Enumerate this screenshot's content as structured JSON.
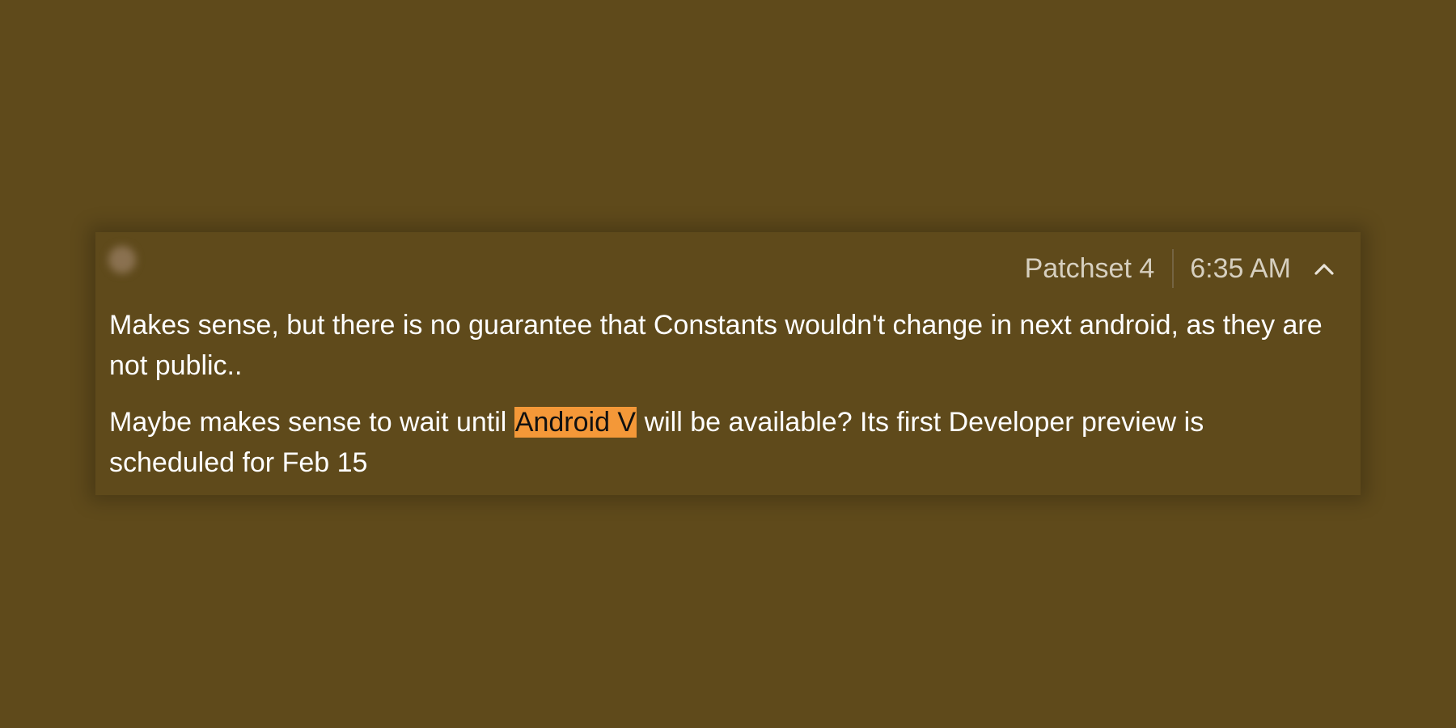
{
  "comment": {
    "author": "",
    "patchset_label": "Patchset 4",
    "time": "6:35 AM",
    "collapse_icon": "chevron-up-icon",
    "paragraphs": {
      "p1": {
        "line1": "Makes sense, but there is no guarantee that Constants wouldn't change in next android, as they are",
        "line2": "not public.."
      },
      "p2": {
        "before": "Maybe makes sense to wait until ",
        "highlight": "Android V",
        "after": " will be available? Its first Developer preview is",
        "line2": "scheduled for Feb 15"
      }
    },
    "colors": {
      "background": "#5f4a1b",
      "highlight": "#f49838",
      "text": "#ffffff",
      "meta_text": "#d6cfbf"
    }
  }
}
